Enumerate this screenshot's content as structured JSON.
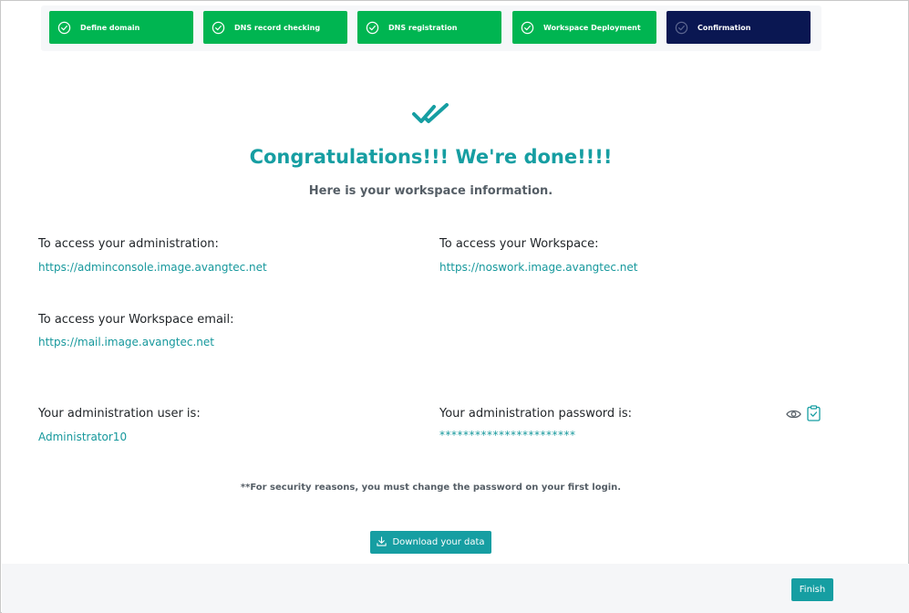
{
  "stepper": {
    "steps": [
      {
        "label": "Define domain",
        "status": "done"
      },
      {
        "label": "DNS record checking",
        "status": "done"
      },
      {
        "label": "DNS registration",
        "status": "done"
      },
      {
        "label": "Workspace Deployment",
        "status": "done"
      },
      {
        "label": "Confirmation",
        "status": "active"
      }
    ]
  },
  "main": {
    "icon": "double-check-icon",
    "title": "Congratulations!!! We're done!!!!",
    "subtitle": "Here is your workspace information.",
    "admin_access": {
      "label": "To access your administration:",
      "url": "https://adminconsole.image.avangtec.net"
    },
    "workspace_access": {
      "label": "To access your Workspace:",
      "url": "https://noswork.image.avangtec.net"
    },
    "email_access": {
      "label": "To access your Workspace email:",
      "url": "https://mail.image.avangtec.net"
    },
    "admin_user": {
      "label": "Your administration user is:",
      "value": "Administrator10"
    },
    "admin_password": {
      "label": "Your administration password is:",
      "value": "***********************",
      "icons": [
        "eye-icon",
        "clipboard-check-icon"
      ]
    },
    "security_notice": "**For security reasons, you must change the password on your first login.",
    "download_label": "Download your data"
  },
  "footer": {
    "finish_label": "Finish"
  },
  "colors": {
    "done_step": "#00b551",
    "active_step": "#0a1752",
    "accent": "#169ea2"
  }
}
